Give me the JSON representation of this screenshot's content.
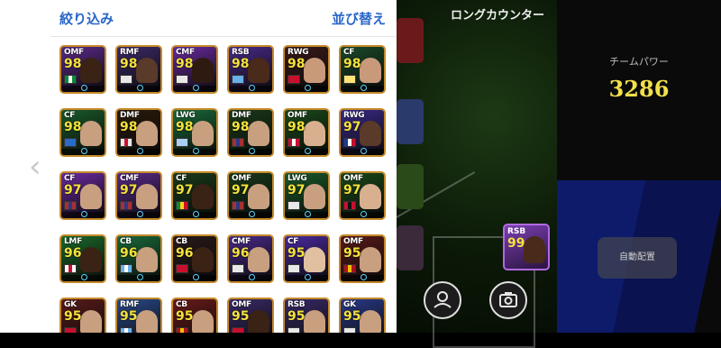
{
  "panel": {
    "filter_label": "絞り込み",
    "sort_label": "並び替え"
  },
  "pitch": {
    "title": "ロングカウンター"
  },
  "right": {
    "team_power_label": "チームパワー",
    "team_power_value": "3286",
    "auto_assign_label": "自動配置"
  },
  "colors": {
    "panel_accent": "#2a66c8",
    "rating": "#f5e23a",
    "team_power": "#f2e04a"
  },
  "field_card": {
    "position": "RSB",
    "rating": "99"
  },
  "cards": [
    {
      "pos": "OMF",
      "rating": "98",
      "bg": "#5b2a8a",
      "border": "#c58a2a",
      "flag": [
        "#0a8a3a",
        "#ffffff",
        "#0a8a3a"
      ],
      "skin": "#3a2215"
    },
    {
      "pos": "RMF",
      "rating": "98",
      "bg": "#3d2a6a",
      "border": "#c58a2a",
      "flag": [
        "#e8e8e8",
        "#e8e8e8",
        "#e8e8e8"
      ],
      "skin": "#5a3a28"
    },
    {
      "pos": "CMF",
      "rating": "98",
      "bg": "#6a2aa0",
      "border": "#c58a2a",
      "flag": [
        "#e8e8e8",
        "#e8e8e8",
        "#e8e8e8"
      ],
      "skin": "#2e1a10"
    },
    {
      "pos": "RSB",
      "rating": "98",
      "bg": "#4a2a8a",
      "border": "#c58a2a",
      "flag": [
        "#6ab0e8",
        "#6ab0e8",
        "#6ab0e8"
      ],
      "skin": "#4a2a1a"
    },
    {
      "pos": "RWG",
      "rating": "98",
      "bg": "#3a1a1a",
      "border": "#c58a2a",
      "flag": [
        "#c8102e",
        "#c8102e",
        "#c8102e"
      ],
      "skin": "#c89a7a"
    },
    {
      "pos": "CF",
      "rating": "98",
      "bg": "#1a4a2a",
      "border": "#c58a2a",
      "flag": [
        "#ffe27a",
        "#ffe27a",
        "#ffe27a"
      ],
      "skin": "#c89a7a"
    },
    {
      "pos": "CF",
      "rating": "98",
      "bg": "#1a5a2a",
      "border": "#c58a2a",
      "flag": [
        "#2a6ac8",
        "#2a6ac8",
        "#2a6ac8"
      ],
      "skin": "#c8a080"
    },
    {
      "pos": "DMF",
      "rating": "98",
      "bg": "#2a1a0a",
      "border": "#c58a2a",
      "flag": [
        "#e8e8e8",
        "#c8102e",
        "#e8e8e8"
      ],
      "skin": "#c8a080"
    },
    {
      "pos": "LWG",
      "rating": "98",
      "bg": "#1a6a3a",
      "border": "#c58a2a",
      "flag": [
        "#a8d0f0",
        "#a8d0f0",
        "#a8d0f0"
      ],
      "skin": "#c8a080"
    },
    {
      "pos": "DMF",
      "rating": "98",
      "bg": "#1a3a1a",
      "border": "#c58a2a",
      "flag": [
        "#a83030",
        "#2a3a8a",
        "#a83030"
      ],
      "skin": "#c8a080"
    },
    {
      "pos": "OMF",
      "rating": "98",
      "bg": "#1a4a1a",
      "border": "#c58a2a",
      "flag": [
        "#c8102e",
        "#ffffff",
        "#c8102e"
      ],
      "skin": "#d8b090"
    },
    {
      "pos": "RWG",
      "rating": "97",
      "bg": "#3a2a8a",
      "border": "#c58a2a",
      "flag": [
        "#1a3a9a",
        "#ffffff",
        "#c8102e"
      ],
      "skin": "#5a3a28"
    },
    {
      "pos": "CF",
      "rating": "97",
      "bg": "#6a2aa0",
      "border": "#c58a2a",
      "flag": [
        "#a83030",
        "#2a3a8a",
        "#a83030"
      ],
      "skin": "#c8a080"
    },
    {
      "pos": "CMF",
      "rating": "97",
      "bg": "#5a2a8a",
      "border": "#c58a2a",
      "flag": [
        "#a83030",
        "#2a3a8a",
        "#a83030"
      ],
      "skin": "#c8a080"
    },
    {
      "pos": "CF",
      "rating": "97",
      "bg": "#1a3a1a",
      "border": "#c58a2a",
      "flag": [
        "#0a8a3a",
        "#fcd116",
        "#ce1126"
      ],
      "skin": "#3a2215"
    },
    {
      "pos": "OMF",
      "rating": "97",
      "bg": "#1a3a1a",
      "border": "#c58a2a",
      "flag": [
        "#a83030",
        "#2a3a8a",
        "#a83030"
      ],
      "skin": "#c8a080"
    },
    {
      "pos": "LWG",
      "rating": "97",
      "bg": "#1a5a2a",
      "border": "#c58a2a",
      "flag": [
        "#e8e8e8",
        "#e8e8e8",
        "#e8e8e8"
      ],
      "skin": "#c8a080"
    },
    {
      "pos": "OMF",
      "rating": "97",
      "bg": "#1a4a1a",
      "border": "#c58a2a",
      "flag": [
        "#c8102e",
        "#111111",
        "#c8102e"
      ],
      "skin": "#d8b090"
    },
    {
      "pos": "LMF",
      "rating": "96",
      "bg": "#1a6a2a",
      "border": "#c58a2a",
      "flag": [
        "#ffffff",
        "#c8102e",
        "#ffffff"
      ],
      "skin": "#3a2215"
    },
    {
      "pos": "CB",
      "rating": "96",
      "bg": "#1a6a3a",
      "border": "#c58a2a",
      "flag": [
        "#6ab0e8",
        "#ffffff",
        "#6ab0e8"
      ],
      "skin": "#c8a080"
    },
    {
      "pos": "CB",
      "rating": "96",
      "bg": "#2a1a1a",
      "border": "#c58a2a",
      "flag": [
        "#c8102e",
        "#c8102e",
        "#c8102e"
      ],
      "skin": "#3a2215"
    },
    {
      "pos": "CMF",
      "rating": "96",
      "bg": "#4a2a8a",
      "border": "#c58a2a",
      "flag": [
        "#e8e8e8",
        "#e8e8e8",
        "#e8e8e8"
      ],
      "skin": "#c8a080"
    },
    {
      "pos": "CF",
      "rating": "95",
      "bg": "#4a2aa0",
      "border": "#c58a2a",
      "flag": [
        "#e8e8e8",
        "#e8e8e8",
        "#e8e8e8"
      ],
      "skin": "#e0c0a0"
    },
    {
      "pos": "OMF",
      "rating": "95",
      "bg": "#5a1a1a",
      "border": "#c58a2a",
      "flag": [
        "#aa151b",
        "#f1bf00",
        "#aa151b"
      ],
      "skin": "#c8a080"
    },
    {
      "pos": "GK",
      "rating": "95",
      "bg": "#5a1a1a",
      "border": "#c58a2a",
      "flag": [
        "#c8102e",
        "#c8102e",
        "#c8102e"
      ],
      "skin": "#c8a080"
    },
    {
      "pos": "RMF",
      "rating": "95",
      "bg": "#2a4a8a",
      "border": "#c58a2a",
      "flag": [
        "#6ab0e8",
        "#ffffff",
        "#6ab0e8"
      ],
      "skin": "#c8a080"
    },
    {
      "pos": "CB",
      "rating": "95",
      "bg": "#6a1a1a",
      "border": "#c58a2a",
      "flag": [
        "#aa151b",
        "#f1bf00",
        "#aa151b"
      ],
      "skin": "#c8a080"
    },
    {
      "pos": "OMF",
      "rating": "95",
      "bg": "#3a2a6a",
      "border": "#c58a2a",
      "flag": [
        "#c8102e",
        "#c8102e",
        "#c8102e"
      ],
      "skin": "#3a2215"
    },
    {
      "pos": "RSB",
      "rating": "95",
      "bg": "#3a2a6a",
      "border": "#c58a2a",
      "flag": [
        "#e8e8e8",
        "#e8e8e8",
        "#e8e8e8"
      ],
      "skin": "#c8a080"
    },
    {
      "pos": "GK",
      "rating": "95",
      "bg": "#2a3a8a",
      "border": "#c58a2a",
      "flag": [
        "#e8e8e8",
        "#e8e8e8",
        "#e8e8e8"
      ],
      "skin": "#c8a080"
    }
  ]
}
